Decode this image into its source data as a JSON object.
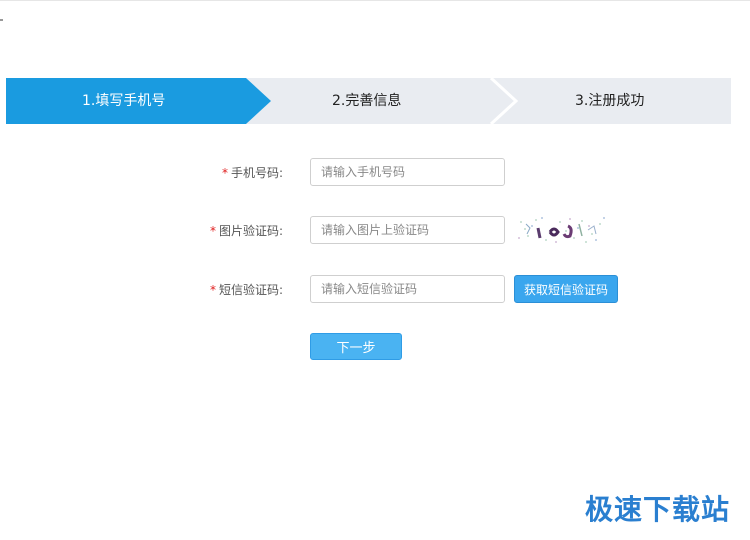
{
  "steps": [
    {
      "label": "1.填写手机号",
      "active": true
    },
    {
      "label": "2.完善信息",
      "active": false
    },
    {
      "label": "3.注册成功",
      "active": false
    }
  ],
  "colors": {
    "step_active": "#1a9be0",
    "step_inactive": "#e9ecf1",
    "required": "#e02020",
    "button": "#3aa6ee",
    "watermark": "#2a7fd0"
  },
  "form": {
    "required_mark": "*",
    "phone": {
      "label": "手机号码:",
      "placeholder": "请输入手机号码",
      "value": ""
    },
    "image_code": {
      "label": "图片验证码:",
      "placeholder": "请输入图片上验证码",
      "value": ""
    },
    "sms_code": {
      "label": "短信验证码:",
      "placeholder": "请输入短信验证码",
      "value": ""
    },
    "get_sms_button": "获取短信验证码",
    "next_button": "下一步"
  },
  "watermark": "极速下载站"
}
